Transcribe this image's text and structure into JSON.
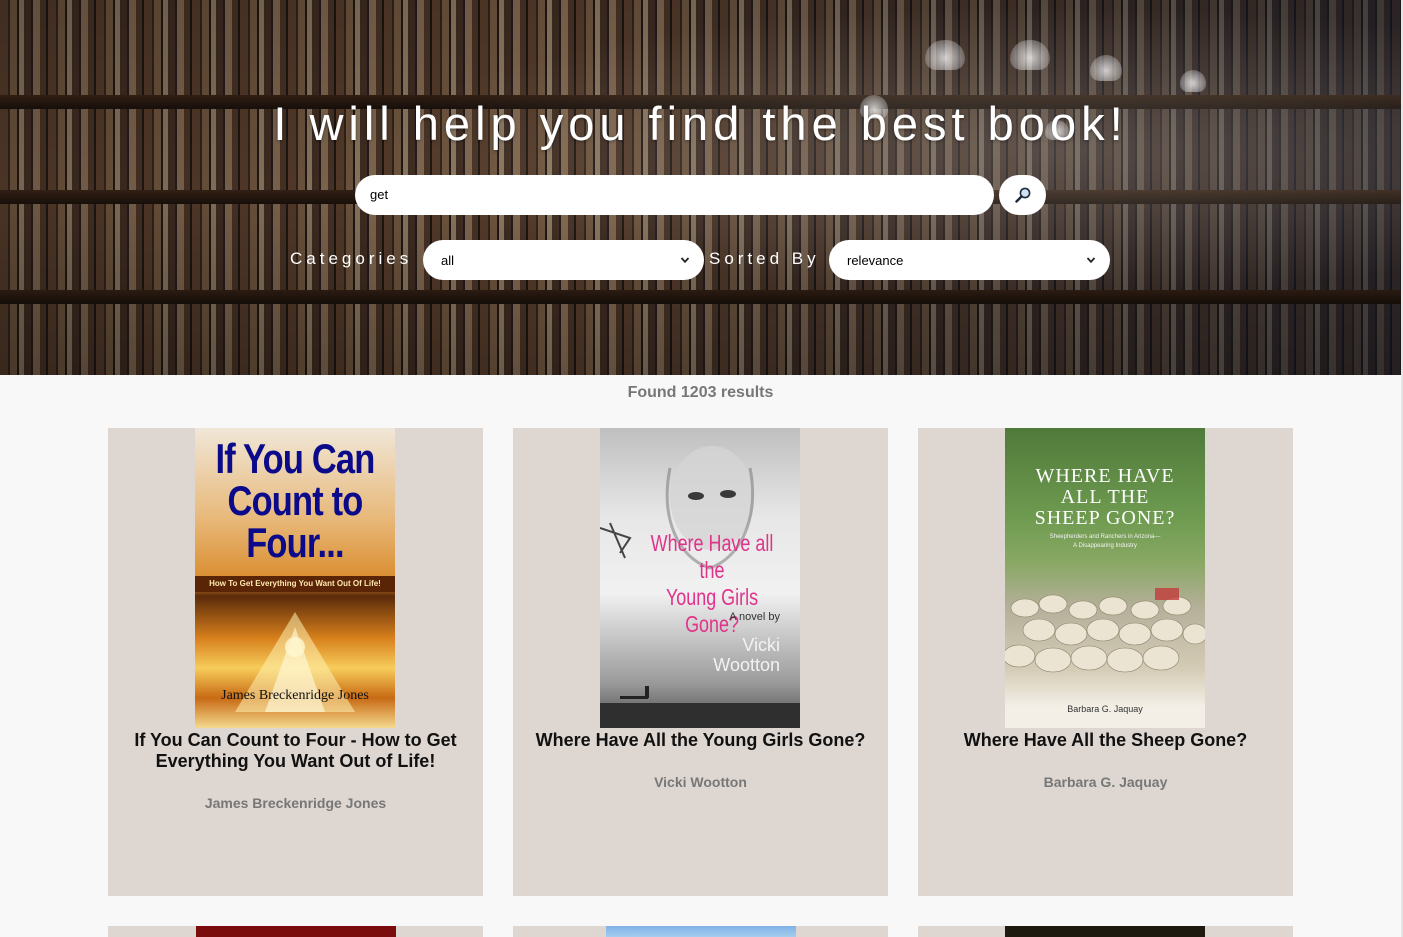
{
  "hero": {
    "title": "I will help you find the best book!"
  },
  "search": {
    "value": "get",
    "button_icon": "magnifier-icon"
  },
  "filters": {
    "categories_label": "Categories",
    "categories_value": "all",
    "sorted_label": "Sorted By",
    "sorted_value": "relevance"
  },
  "results": {
    "count_text": "Found 1203 results",
    "books": [
      {
        "title": "If You Can Count to Four - How to Get Everything You Want Out of Life!",
        "author": "James Breckenridge Jones",
        "cover": {
          "line1": "If You Can",
          "line2": "Count to",
          "line3": "Four...",
          "subtitle": "How To Get Everything You Want Out Of Life!",
          "author": "James Breckenridge Jones"
        }
      },
      {
        "title": "Where Have All the Young Girls Gone?",
        "author": "Vicki Wootton",
        "cover": {
          "line1": "Where Have all the",
          "line2": "Young Girls Gone?",
          "novel_by": "A novel by",
          "author1": "Vicki",
          "author2": "Wootton"
        }
      },
      {
        "title": "Where Have All the Sheep Gone?",
        "author": "Barbara G. Jaquay",
        "cover": {
          "line1": "Where Have",
          "line2": "All the",
          "line3": "Sheep Gone?",
          "subtitle1": "Sheepherders and Ranchers in Arizona—",
          "subtitle2": "A Disappearing Industry",
          "author": "Barbara G. Jaquay"
        }
      }
    ]
  },
  "colors": {
    "card_bg": "#ded7d1",
    "page_bg": "#f8f8f8",
    "muted_text": "#777777",
    "cover1_title": "#0a0a8a",
    "cover2_title": "#e0338a"
  }
}
